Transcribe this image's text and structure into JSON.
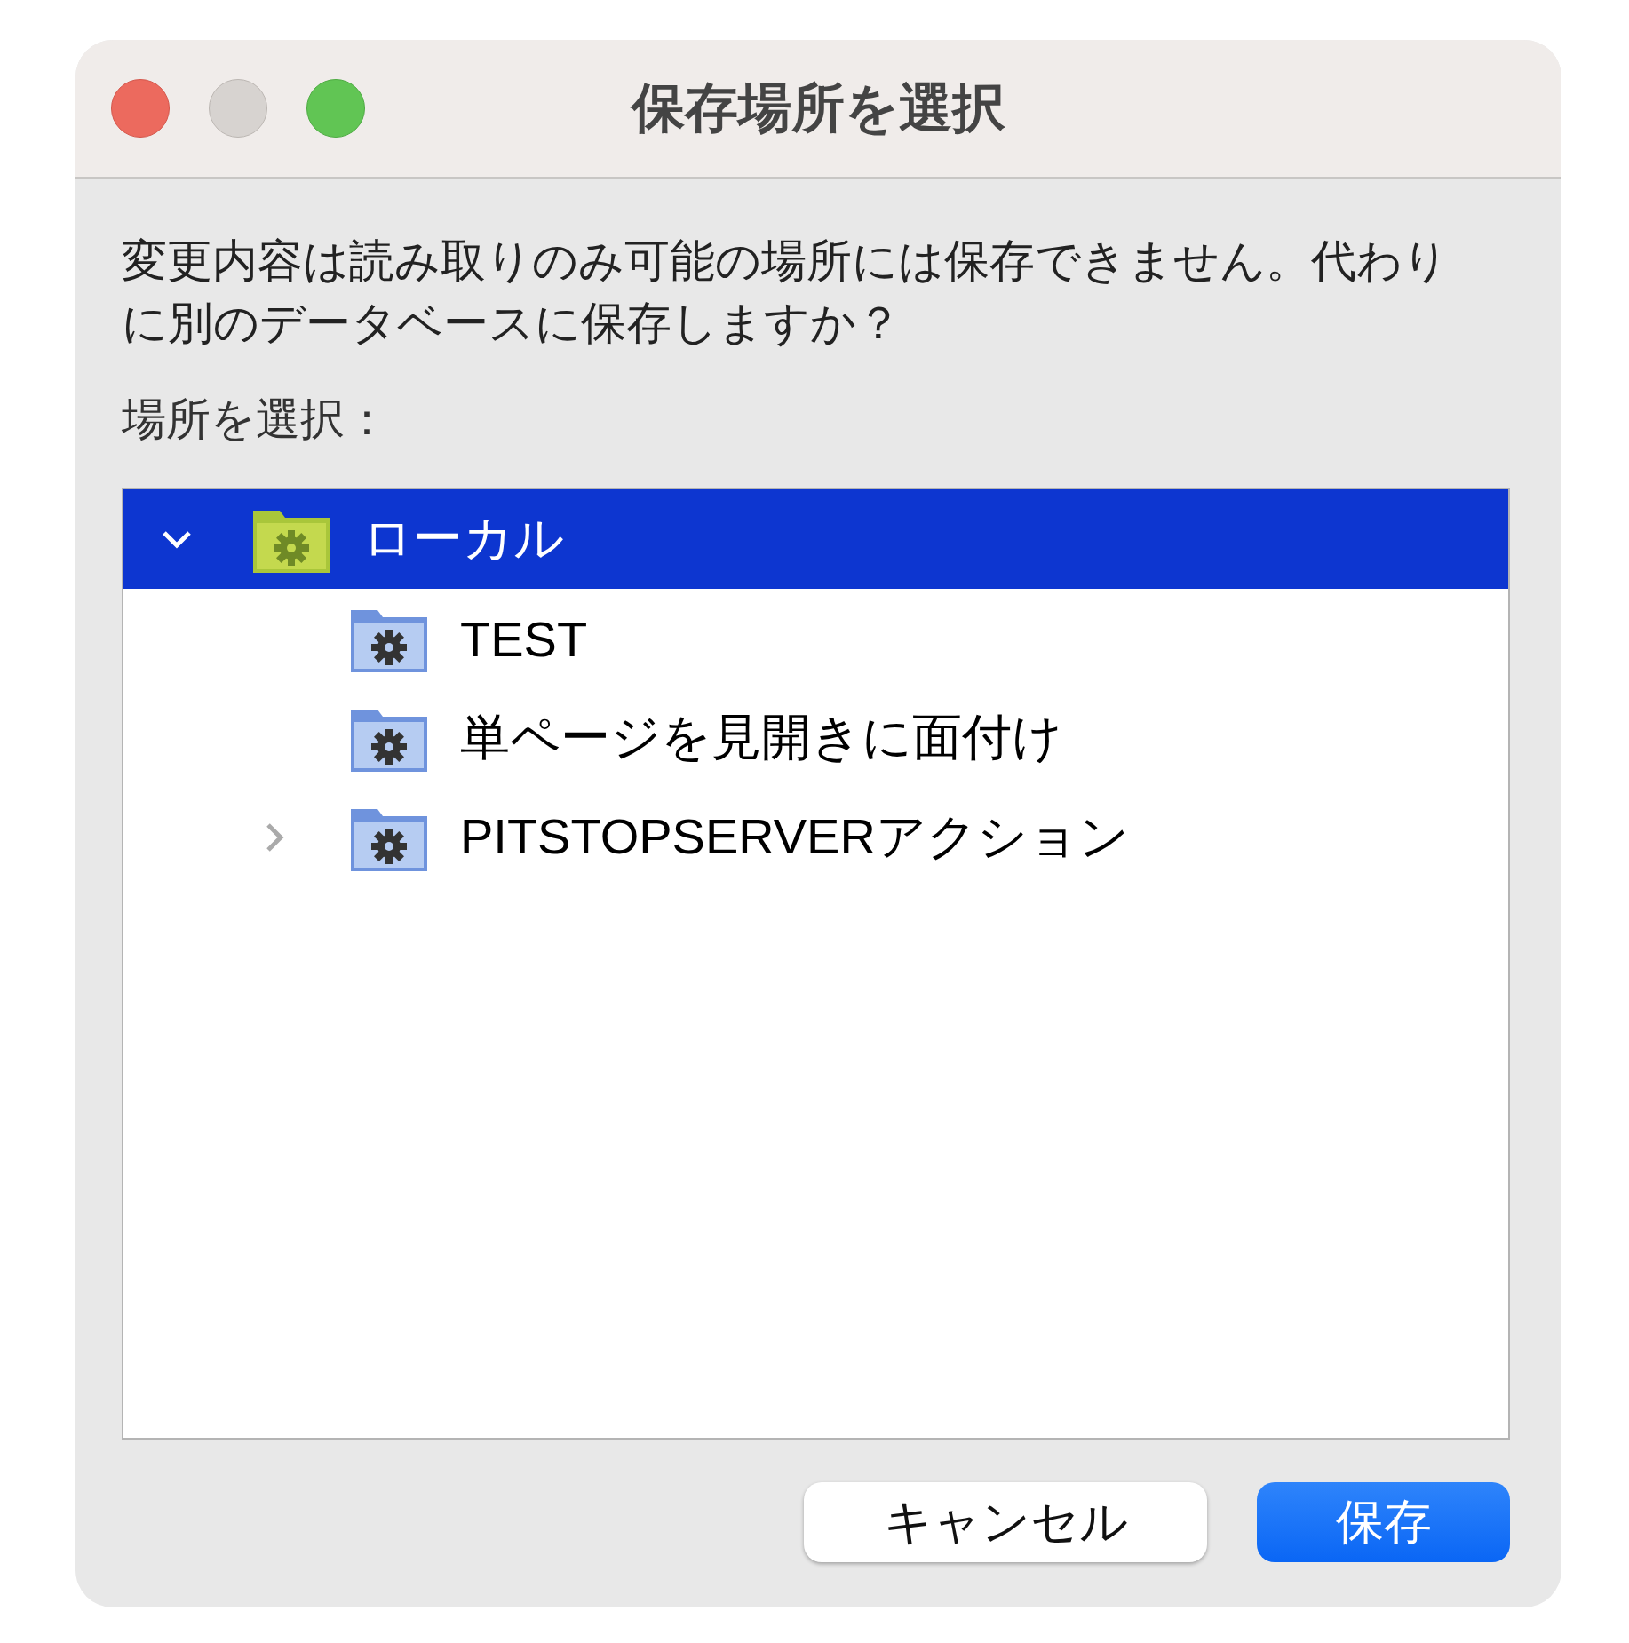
{
  "window": {
    "title": "保存場所を選択"
  },
  "message": "変更内容は読み取りのみ可能の場所には保存できません。代わりに別のデータベースに保存しますか？",
  "location_label": "場所を選択：",
  "tree": [
    {
      "label": "ローカル",
      "kind": "root",
      "selected": true,
      "expanded": true,
      "children": [
        {
          "label": "TEST",
          "kind": "folder",
          "selected": false
        },
        {
          "label": "単ページを見開きに面付け",
          "kind": "folder",
          "selected": false
        },
        {
          "label": "PITSTOPSERVERアクション",
          "kind": "folder",
          "selected": false,
          "expanded": false
        }
      ]
    }
  ],
  "buttons": [
    {
      "label": "キャンセル",
      "kind": "secondary"
    },
    {
      "label": "保存",
      "kind": "primary"
    }
  ]
}
